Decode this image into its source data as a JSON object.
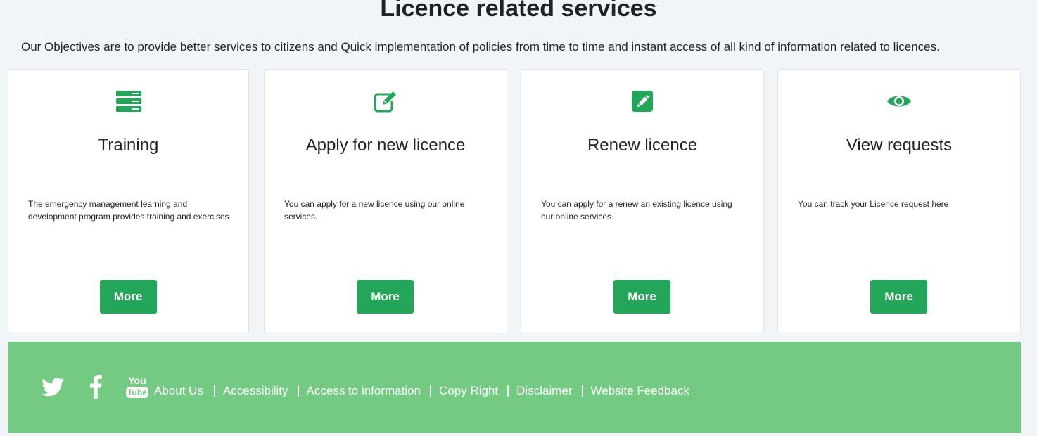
{
  "page": {
    "title": "Licence related services",
    "intro": "Our Objectives are to provide better services to citizens and Quick implementation of policies from time to time and instant access of all kind of information related to licences."
  },
  "colors": {
    "accent": "#23a659",
    "footer_bg": "#74c983",
    "page_bg": "#f2f5f8"
  },
  "cards": [
    {
      "icon": "server-icon",
      "title": "Training",
      "description": "The emergency management learning and development program provides training and exercises",
      "button": "More"
    },
    {
      "icon": "edit-icon",
      "title": "Apply for new licence",
      "description": "You can apply for a new licence using our online services.",
      "button": "More"
    },
    {
      "icon": "pencil-square-icon",
      "title": "Renew licence",
      "description": "You can apply for a renew an existing licence using our online services.",
      "button": "More"
    },
    {
      "icon": "eye-icon",
      "title": "View requests",
      "description": "You can track your Licence request here",
      "button": "More"
    }
  ],
  "footer": {
    "social": [
      "twitter-icon",
      "facebook-icon",
      "youtube-icon"
    ],
    "youtube_text_top": "You",
    "youtube_text_bottom": "Tube",
    "links": [
      "About Us",
      "Accessibility",
      "Access to information",
      "Copy Right",
      "Disclaimer",
      "Website Feedback"
    ]
  }
}
